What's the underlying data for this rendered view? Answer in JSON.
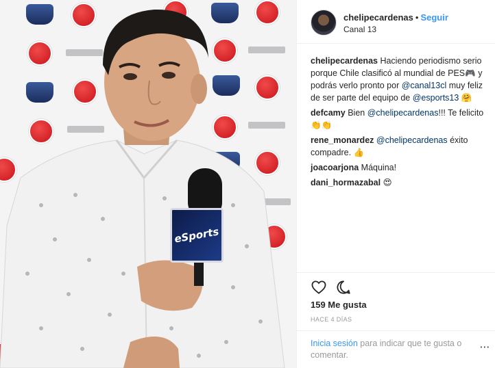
{
  "post": {
    "username": "chelipecardenas",
    "separator": "•",
    "follow_label": "Seguir",
    "location": "Canal 13"
  },
  "caption": {
    "username": "chelipecardenas",
    "text_1": "Haciendo periodismo serio porque Chile clasificó al mundial de PES",
    "emoji_1": "🎮",
    "text_2": "y podrás verlo pronto por",
    "mention_1": "@canal13cl",
    "text_3": "muy feliz de ser parte del equipo de",
    "mention_2": "@esports13",
    "emoji_2": "🤗"
  },
  "comments": [
    {
      "username": "defcamy",
      "text_1": "Bien",
      "mention": "@chelipecardenas",
      "text_2": "!!! Te felicito",
      "emoji": "👏👏"
    },
    {
      "username": "rene_monardez",
      "mention": "@chelipecardenas",
      "text_1": "éxito compadre.",
      "emoji": "👍"
    },
    {
      "username": "joacoarjona",
      "text_1": "Máquina!"
    },
    {
      "username": "dani_hormazabal",
      "emoji": "😍"
    }
  ],
  "actions": {
    "like_icon": "heart-icon",
    "comment_icon": "comment-icon",
    "likes_text": "159 Me gusta",
    "time_text": "HACE 4 DÍAS"
  },
  "login": {
    "link": "Inicia sesión",
    "text": "para indicar que te gusta o comentar.",
    "more": "⋯"
  },
  "photo": {
    "mic_label": "eSports"
  },
  "colors": {
    "accent": "#3897f0",
    "mention": "#003569",
    "muted": "#999999",
    "text": "#262626"
  }
}
